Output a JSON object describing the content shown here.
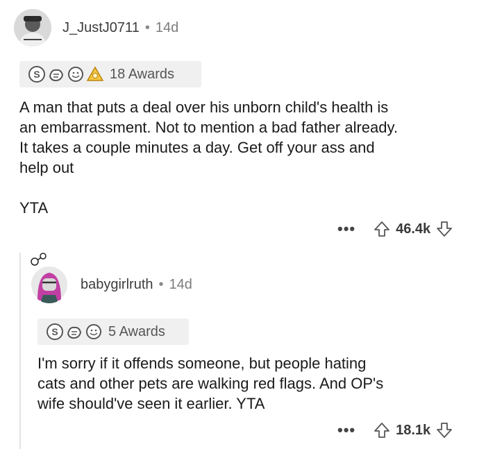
{
  "comment1": {
    "username": "J_JustJ0711",
    "separator": "•",
    "age": "14d",
    "awards_label": "18 Awards",
    "award_icons": [
      "silver-award-icon",
      "wholesome-award-icon",
      "helpful-award-icon",
      "gold-award-icon"
    ],
    "text_lines": [
      "A man that puts a deal over his unborn child's health is",
      "an embarrassment. Not to mention a bad father already.",
      "It takes a couple minutes a day. Get off your ass and",
      "help out"
    ],
    "verdict": "YTA",
    "more": "•••",
    "score": "46.4k"
  },
  "comment2": {
    "username": "babygirlruth",
    "separator": "•",
    "age": "14d",
    "awards_label": "5 Awards",
    "award_icons": [
      "silver-award-icon",
      "wholesome-award-icon",
      "helpful-award-icon"
    ],
    "text_lines": [
      "I'm sorry if it offends someone, but people hating",
      "cats and other pets are walking red flags. And OP's",
      "wife should've seen it earlier. YTA"
    ],
    "more": "•••",
    "score": "18.1k"
  }
}
